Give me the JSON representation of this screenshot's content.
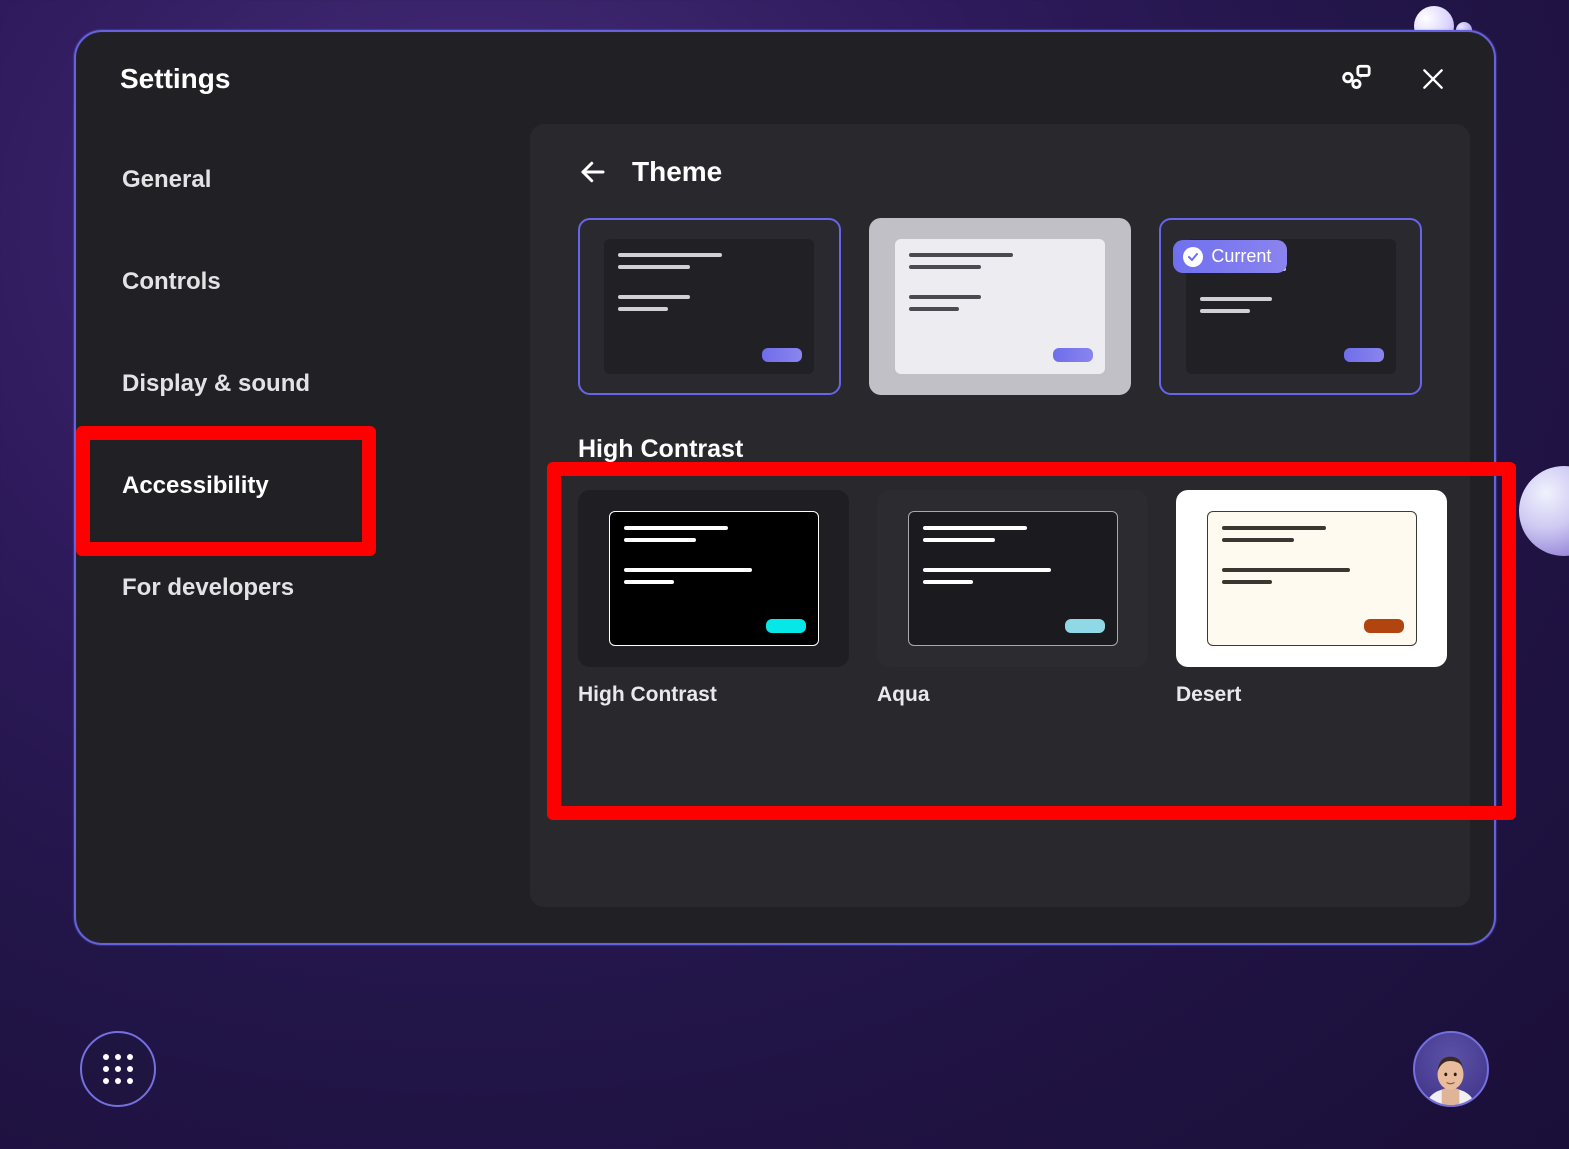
{
  "window": {
    "title": "Settings"
  },
  "sidebar": {
    "items": [
      {
        "label": "General"
      },
      {
        "label": "Controls"
      },
      {
        "label": "Display & sound"
      },
      {
        "label": "Accessibility"
      },
      {
        "label": "For developers"
      }
    ]
  },
  "content": {
    "title": "Theme",
    "current_badge": "Current",
    "high_contrast_title": "High Contrast",
    "themes": {
      "hc_black_label": "High Contrast",
      "aqua_label": "Aqua",
      "desert_label": "Desert"
    }
  },
  "colors": {
    "accent": "#6f6deb",
    "highlight": "#ff0000"
  }
}
